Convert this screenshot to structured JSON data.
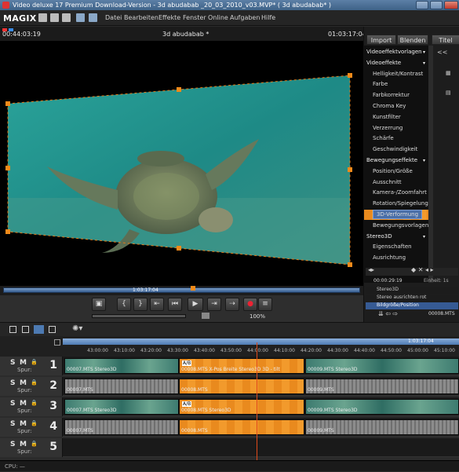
{
  "window": {
    "title": "Video deluxe 17 Premium Download-Version - 3d abudabab _20_03_2010_v03.MVP* ( 3d abudabab* )"
  },
  "app": {
    "logo": "MAGIX"
  },
  "menu": {
    "items": [
      "Datei",
      "Bearbeiten",
      "Effekte",
      "Fenster",
      "Online",
      "Aufgaben",
      "Hilfe"
    ]
  },
  "monitor": {
    "timecode_left": "00:44:03:19",
    "title": "3d abudabab *",
    "timecode_right": "01:03:17:04"
  },
  "scrubber": {
    "position_label": "1:03:17:04"
  },
  "transport": {
    "zoom": "100%"
  },
  "right_panel": {
    "tabs": [
      "Import",
      "Blenden",
      "Titel"
    ],
    "effects": [
      {
        "label": "Videoeffektvorlagen",
        "type": "header"
      },
      {
        "label": "Videoeffekte",
        "type": "header"
      },
      {
        "label": "Helligkeit/Kontrast",
        "type": "item"
      },
      {
        "label": "Farbe",
        "type": "item"
      },
      {
        "label": "Farbkorrektur",
        "type": "item"
      },
      {
        "label": "Chroma Key",
        "type": "item"
      },
      {
        "label": "Kunstfilter",
        "type": "item"
      },
      {
        "label": "Verzerrung",
        "type": "item"
      },
      {
        "label": "Schärfe",
        "type": "item"
      },
      {
        "label": "Geschwindigkeit",
        "type": "item"
      },
      {
        "label": "Bewegungseffekte",
        "type": "header"
      },
      {
        "label": "Position/Größe",
        "type": "item"
      },
      {
        "label": "Ausschnitt",
        "type": "item"
      },
      {
        "label": "Kamera-/Zoomfahrt",
        "type": "item"
      },
      {
        "label": "Rotation/Spiegelung",
        "type": "item"
      },
      {
        "label": "3D-Verformung",
        "type": "item",
        "selected": true
      },
      {
        "label": "Bewegungsvorlagen",
        "type": "item"
      },
      {
        "label": "Stereo3D",
        "type": "header"
      },
      {
        "label": "Eigenschaften",
        "type": "item"
      },
      {
        "label": "Ausrichtung",
        "type": "item"
      }
    ],
    "keyframe": {
      "time": "00:00:29:19",
      "unit_label": "Einheit: 1s"
    },
    "params": [
      "Stereo3D",
      "Stereo ausrichten rot",
      "Bildgröße/Position"
    ],
    "footer_clip": "00008.MTS"
  },
  "timeline": {
    "ruler_label": "1:03:17:04",
    "ruler_ticks": [
      "43:00:00",
      "43:10:00",
      "43:20:00",
      "43:30:00",
      "43:40:00",
      "43:50:00",
      "44:00:00",
      "44:10:00",
      "44:20:00",
      "44:30:00",
      "44:40:00",
      "44:50:00",
      "45:00:00",
      "45:10:00"
    ],
    "track_controls": {
      "s": "S",
      "m": "M",
      "spur": "Spur:"
    },
    "tracks": [
      {
        "num": "1",
        "clips": [
          "00007.MTS Stereo3D",
          "00008.MTS X-Pos Breite Stereo3D 3D - tilt",
          "00009.MTS Stereo3D"
        ]
      },
      {
        "num": "2",
        "clips": [
          "00007.MTS",
          "00008.MTS",
          "00009.MTS"
        ]
      },
      {
        "num": "3",
        "clips": [
          "00007.MTS Stereo3D",
          "00008.MTS Stereo3D",
          "00009.MTS Stereo3D"
        ]
      },
      {
        "num": "4",
        "clips": [
          "00007.MTS",
          "00008.MTS",
          "00009.MTS"
        ]
      },
      {
        "num": "5",
        "clips": []
      }
    ],
    "clip_badge": "A/B"
  },
  "status": {
    "cpu": "CPU: —"
  }
}
